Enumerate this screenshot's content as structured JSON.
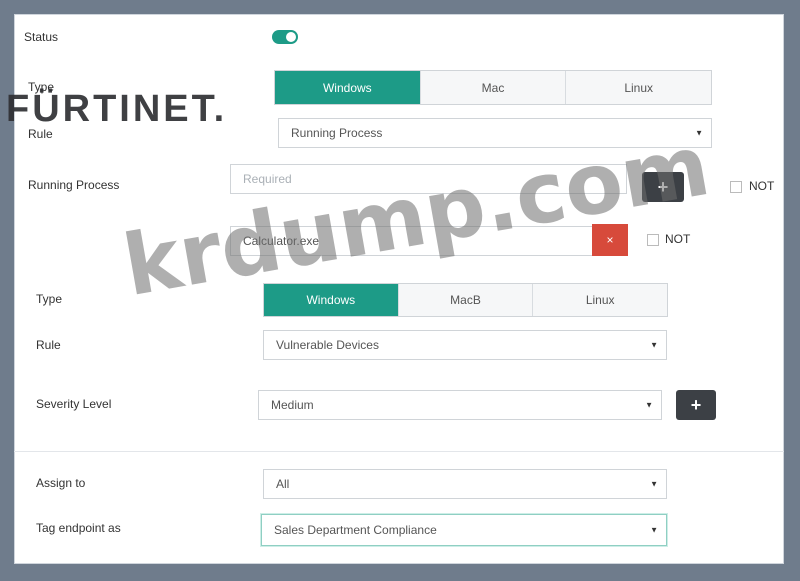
{
  "labels": {
    "status": "Status",
    "type": "Type",
    "rule": "Rule",
    "running_process": "Running Process",
    "type2": "Type",
    "rule2": "Rule",
    "severity_level": "Severity Level",
    "assign_to": "Assign to",
    "tag_endpoint_as": "Tag endpoint as"
  },
  "type_options": [
    "Windows",
    "Mac",
    "Linux"
  ],
  "type_options2": [
    "Windows",
    "MacB",
    "Linux"
  ],
  "rule_value": "Running Process",
  "process_placeholder": "Required",
  "process_value": "Calculator.exe",
  "not_label": "NOT",
  "rule2_value": "Vulnerable Devices",
  "severity_value": "Medium",
  "assign_value": "All",
  "tag_value": "Sales Department Compliance",
  "buttons": {
    "add": "+",
    "remove": "×"
  },
  "logo_text": "FÜRTINET.",
  "watermark_text": "krdump.com",
  "colors": {
    "accent": "#1d9b87",
    "danger": "#d74a3b",
    "dark_button": "#3c4045"
  }
}
